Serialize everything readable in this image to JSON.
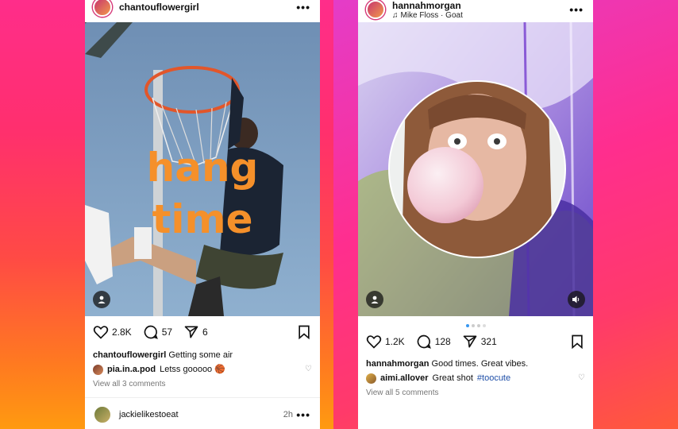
{
  "post1": {
    "username": "chantouflowergirl",
    "overlay_text": [
      "hang",
      "time"
    ],
    "likes": "2.8K",
    "comments": "57",
    "shares": "6",
    "caption_user": "chantouflowergirl",
    "caption_text": "Getting some air",
    "comment_user": "pia.in.a.pod",
    "comment_text": "Letss gooooo 🏀",
    "view_all": "View all 3 comments",
    "next_user": "jackielikestoeat",
    "next_time": "2h"
  },
  "post2": {
    "username": "hannahmorgan",
    "audio": "Mike Floss · Goat",
    "likes": "1.2K",
    "comments": "128",
    "shares": "321",
    "caption_user": "hannahmorgan",
    "caption_text": "Good times. Great vibes.",
    "comment_user": "aimi.allover",
    "comment_text": "Great shot",
    "comment_tag": "#toocute",
    "view_all": "View all 5 comments"
  },
  "icons": {
    "more": "•••",
    "like": "heart-icon",
    "comment": "comment-icon",
    "share": "send-icon",
    "save": "bookmark-icon"
  },
  "colors": {
    "accent": "#3897f0",
    "overlay_text": "#f5902a",
    "tag": "#1f4fa8"
  }
}
